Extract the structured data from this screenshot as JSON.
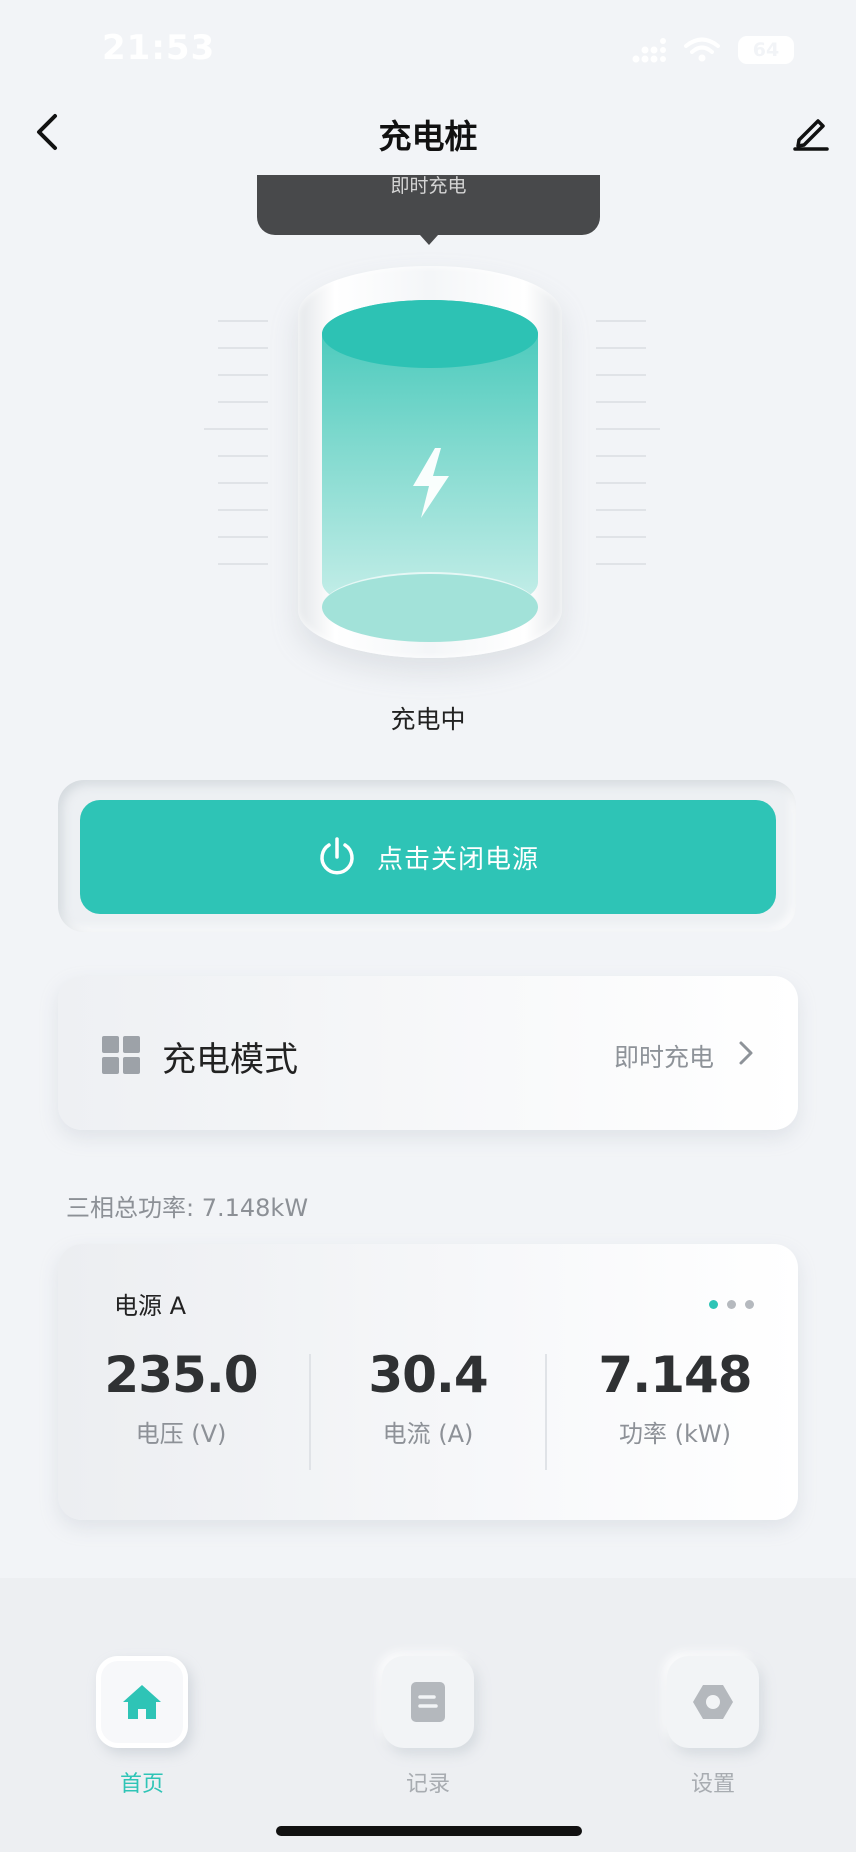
{
  "status_bar": {
    "time": "21:53",
    "battery": "64"
  },
  "header": {
    "title": "充电桩"
  },
  "tooltip": {
    "text": "即时充电"
  },
  "charger": {
    "status": "充电中"
  },
  "power_button": {
    "label": "点击关闭电源"
  },
  "charge_mode": {
    "title": "充电模式",
    "value": "即时充电"
  },
  "total_power": {
    "text": "三相总功率: 7.148kW"
  },
  "power_source": {
    "title": "电源 A",
    "page_indicator": {
      "count": 3,
      "active_index": 0
    },
    "metrics": [
      {
        "value": "235.0",
        "label": "电压 (V)"
      },
      {
        "value": "30.4",
        "label": "电流 (A)"
      },
      {
        "value": "7.148",
        "label": "功率 (kW)"
      }
    ]
  },
  "bottom_nav": {
    "items": [
      {
        "label": "首页",
        "icon": "home-icon",
        "active": true
      },
      {
        "label": "记录",
        "icon": "record-icon",
        "active": false
      },
      {
        "label": "设置",
        "icon": "settings-icon",
        "active": false
      }
    ]
  },
  "colors": {
    "accent": "#2ec4b6",
    "tooltip_bg": "#48494b",
    "background": "#f2f4f7"
  }
}
